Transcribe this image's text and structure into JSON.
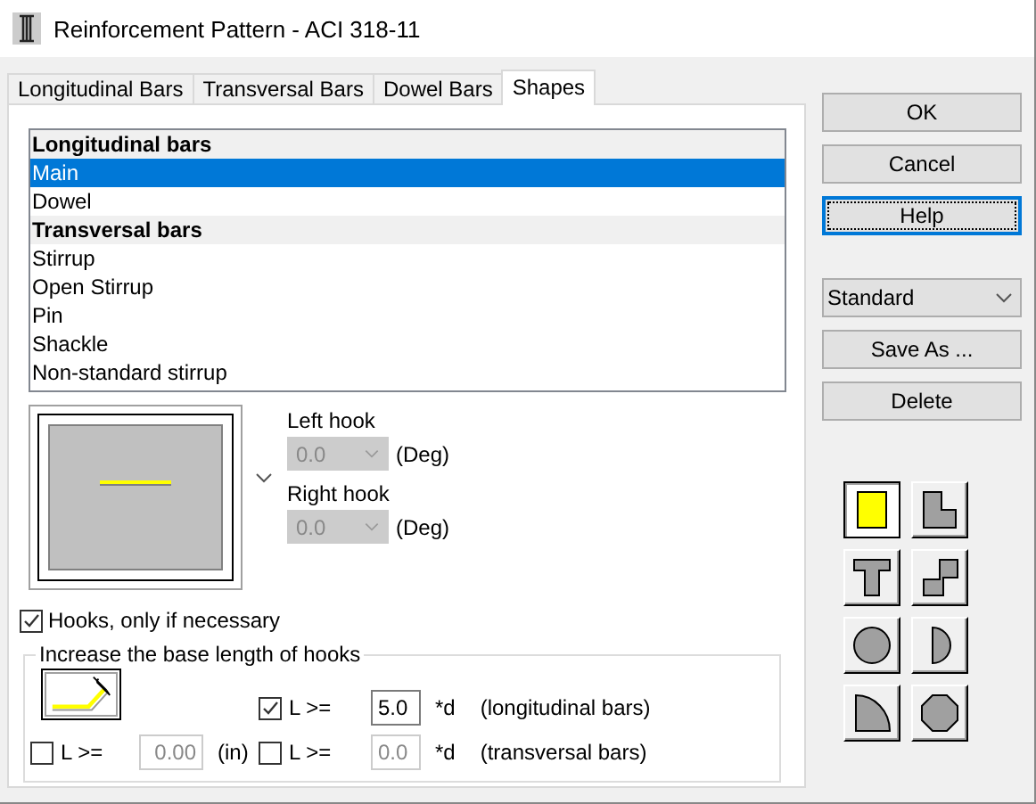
{
  "window": {
    "title": "Reinforcement Pattern - ACI 318-11"
  },
  "tabs": [
    {
      "label": "Longitudinal Bars",
      "selected": false
    },
    {
      "label": "Transversal Bars",
      "selected": false
    },
    {
      "label": "Dowel Bars",
      "selected": false
    },
    {
      "label": "Shapes",
      "selected": true
    }
  ],
  "shape_list": [
    {
      "kind": "header",
      "label": "Longitudinal bars"
    },
    {
      "kind": "item",
      "label": "Main",
      "selected": true
    },
    {
      "kind": "item",
      "label": "Dowel",
      "selected": false
    },
    {
      "kind": "header",
      "label": "Transversal bars"
    },
    {
      "kind": "item",
      "label": "Stirrup",
      "selected": false
    },
    {
      "kind": "item",
      "label": "Open Stirrup",
      "selected": false
    },
    {
      "kind": "item",
      "label": "Pin",
      "selected": false
    },
    {
      "kind": "item",
      "label": "Shackle",
      "selected": false
    },
    {
      "kind": "item",
      "label": "Non-standard stirrup",
      "selected": false
    }
  ],
  "hooks": [
    {
      "label": "Left hook",
      "value": "0.0",
      "unit": "(Deg)",
      "disabled": true
    },
    {
      "label": "Right hook",
      "value": "0.0",
      "unit": "(Deg)",
      "disabled": true
    }
  ],
  "hooks_only_if_necessary": {
    "label": "Hooks, only if necessary",
    "checked": true
  },
  "base_length": {
    "title": "Increase the base length of hooks",
    "rules": [
      {
        "checked": true,
        "label": "L >=",
        "value": "5.0",
        "unit": "*d",
        "note": "(longitudinal bars)",
        "disabled": false
      },
      {
        "checked": false,
        "label": "L >=",
        "value": "0.00",
        "unit": "(in)",
        "disabled": true
      },
      {
        "checked": false,
        "label": "L >=",
        "value": "0.0",
        "unit": "*d",
        "note": "(transversal bars)",
        "disabled": true
      }
    ]
  },
  "buttons": [
    {
      "label": "OK",
      "focused": false
    },
    {
      "label": "Cancel",
      "focused": false
    },
    {
      "label": "Help",
      "focused": true
    }
  ],
  "preset": {
    "value": "Standard"
  },
  "preset_buttons": [
    "Save As ...",
    "Delete"
  ],
  "shapes": [
    {
      "kind": "rectangle",
      "selected": true
    },
    {
      "kind": "l-shape",
      "selected": false
    },
    {
      "kind": "t-shape",
      "selected": false
    },
    {
      "kind": "z-shape",
      "selected": false
    },
    {
      "kind": "circle",
      "selected": false
    },
    {
      "kind": "half-circle",
      "selected": false
    },
    {
      "kind": "quarter-circle",
      "selected": false
    },
    {
      "kind": "octagon",
      "selected": false
    }
  ]
}
